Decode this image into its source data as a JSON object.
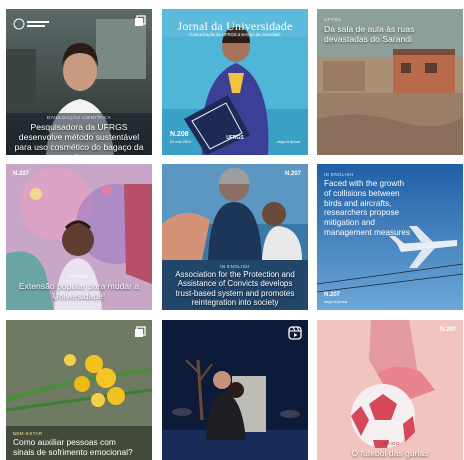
{
  "tiles": [
    {
      "kicker": "Divulgação científica",
      "caption": "Pesquisadora da UFRGS desenvolve método sustentável para uso cosmético do bagaço da oliva",
      "icon": "carousel-icon"
    },
    {
      "masthead": "Jornal da Universidade",
      "masthead_sub": "Comunicação da UFRGS a serviço da sociedade",
      "edition": "N.208",
      "edition_date": "02 mai 2024",
      "logo": "UFRGS",
      "handle": "ufrgs.br/jornal"
    },
    {
      "kicker": "UFTSO",
      "caption": "Da sala de aula às ruas devastadas do Sarandi"
    },
    {
      "edition": "N.207",
      "kicker": "Artigo",
      "caption": "Extensão popular para mudar a Universidade!"
    },
    {
      "edition": "N.207",
      "kicker": "In English",
      "caption": "Association for the Protection and Assistance of Convicts develops trust-based system and promotes reintegration into society"
    },
    {
      "kicker": "In English",
      "caption": "Faced with the growth of collisions between birds and aircrafts, researchers propose mitigation and management measures",
      "edition": "N.207",
      "edition_date": "ufrgs.br/jornal"
    },
    {
      "kicker": "Bem-estar",
      "caption": "Como auxiliar pessoas com sinais de sofrimento emocional?",
      "icon": "carousel-icon"
    },
    {
      "icon": "reels-icon"
    },
    {
      "edition": "N.207",
      "kicker": "Artigo",
      "caption": "O futebol das gurias"
    }
  ]
}
